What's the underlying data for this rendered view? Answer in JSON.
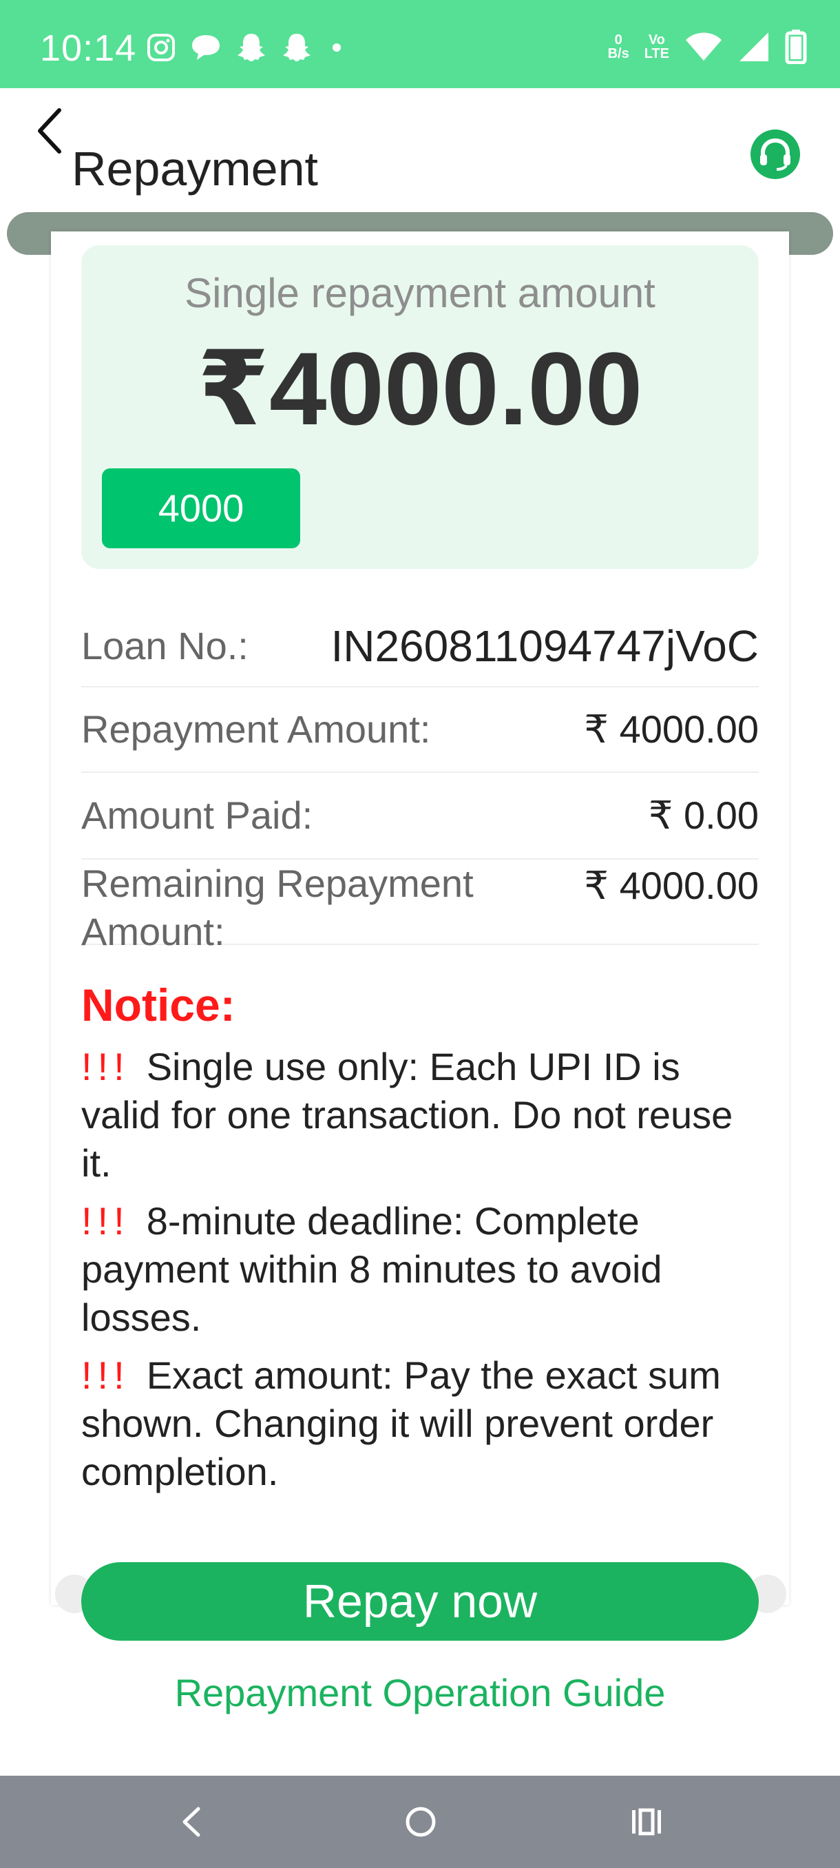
{
  "status_bar": {
    "time": "10:14",
    "net_speed_value": "0",
    "net_speed_unit": "B/s",
    "volte_top": "Vo",
    "volte_bottom": "LTE"
  },
  "header": {
    "title": "Repayment"
  },
  "amount_card": {
    "caption": "Single repayment amount",
    "amount": "₹4000.00",
    "chip_label": "4000"
  },
  "details": [
    {
      "label": "Loan No.:",
      "value": "IN260811094747jVoC"
    },
    {
      "label": "Repayment Amount:",
      "value": "₹ 4000.00"
    },
    {
      "label": "Amount Paid:",
      "value": "₹ 0.00"
    },
    {
      "label": "Remaining Repayment Amount:",
      "value": "₹ 4000.00"
    }
  ],
  "notice": {
    "title": "Notice:",
    "marker": "!!!",
    "items": [
      "Single use only: Each UPI ID is valid for one transaction. Do not reuse it.",
      "8-minute deadline: Complete payment within 8 minutes to avoid losses.",
      "Exact amount: Pay the exact sum shown. Changing it will prevent order completion."
    ]
  },
  "actions": {
    "repay_label": "Repay now",
    "guide_label": "Repayment Operation Guide"
  },
  "colors": {
    "status_bar": "#56e095",
    "accent_green": "#1bb35f",
    "chip_green": "#00c46e",
    "amount_bg": "#e8f8ef",
    "notice_red": "#ff1a1a",
    "nav_bar": "#868a92"
  },
  "icons": {
    "status_left": [
      "instagram-icon",
      "chat-bubble-icon",
      "snapchat-icon",
      "snapchat-icon",
      "dot-icon"
    ],
    "status_right": [
      "data-speed-icon",
      "volte-icon",
      "wifi-icon",
      "signal-icon",
      "battery-icon"
    ],
    "header": [
      "back-arrow-icon",
      "customer-support-icon"
    ],
    "nav": [
      "nav-back-icon",
      "nav-home-icon",
      "nav-recent-apps-icon"
    ]
  }
}
